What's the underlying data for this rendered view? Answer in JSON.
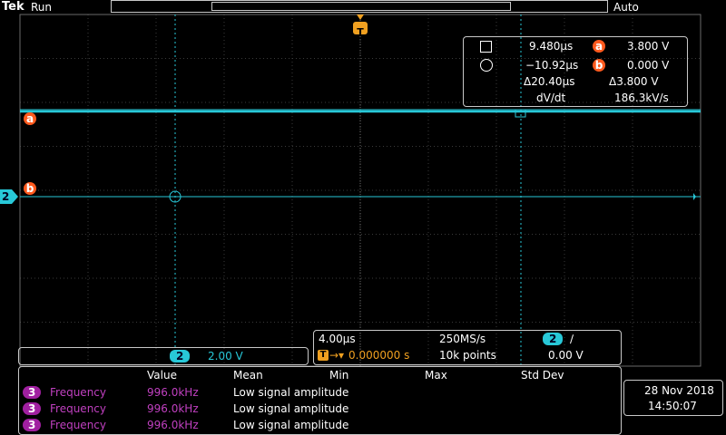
{
  "top": {
    "brand": "Tek",
    "status": "Run",
    "trigger_mode": "Auto"
  },
  "cursor_readout": {
    "a_time": "9.480µs",
    "a_label": "a",
    "a_value": "3.800 V",
    "b_time": "−10.92µs",
    "b_label": "b",
    "b_value": "0.000 V",
    "delta_time": "Δ20.40µs",
    "delta_value": "Δ3.800 V",
    "rate_label": "dV/dt",
    "rate_value": "186.3kV/s"
  },
  "markers": {
    "cursor_a": "a",
    "cursor_b": "b",
    "channel_ref": "2",
    "trigger": "T"
  },
  "channel": {
    "number": "2",
    "scale": "2.00 V"
  },
  "timebase": {
    "time_per_div": "4.00µs",
    "sample_rate": "250MS/s",
    "trigger_channel": "2",
    "trigger_slope": "∕",
    "trigger_position": "0.000000 s",
    "record_length": "10k points",
    "trigger_level": "0.00 V"
  },
  "measurements": {
    "headers": [
      "Value",
      "Mean",
      "Min",
      "Max",
      "Std Dev"
    ],
    "rows": [
      {
        "channel": "3",
        "name": "Frequency",
        "value": "996.0kHz",
        "note": "Low signal amplitude"
      },
      {
        "channel": "3",
        "name": "Frequency",
        "value": "996.0kHz",
        "note": "Low signal amplitude"
      },
      {
        "channel": "3",
        "name": "Frequency",
        "value": "996.0kHz",
        "note": "Low signal amplitude"
      }
    ]
  },
  "datetime": {
    "date": "28 Nov 2018",
    "time": "14:50:07"
  },
  "colors": {
    "trace": "#28c8d8",
    "cursor_badge": "#ff5a1e",
    "measurement_channel": "#a020a0",
    "trigger": "#f0a020"
  }
}
